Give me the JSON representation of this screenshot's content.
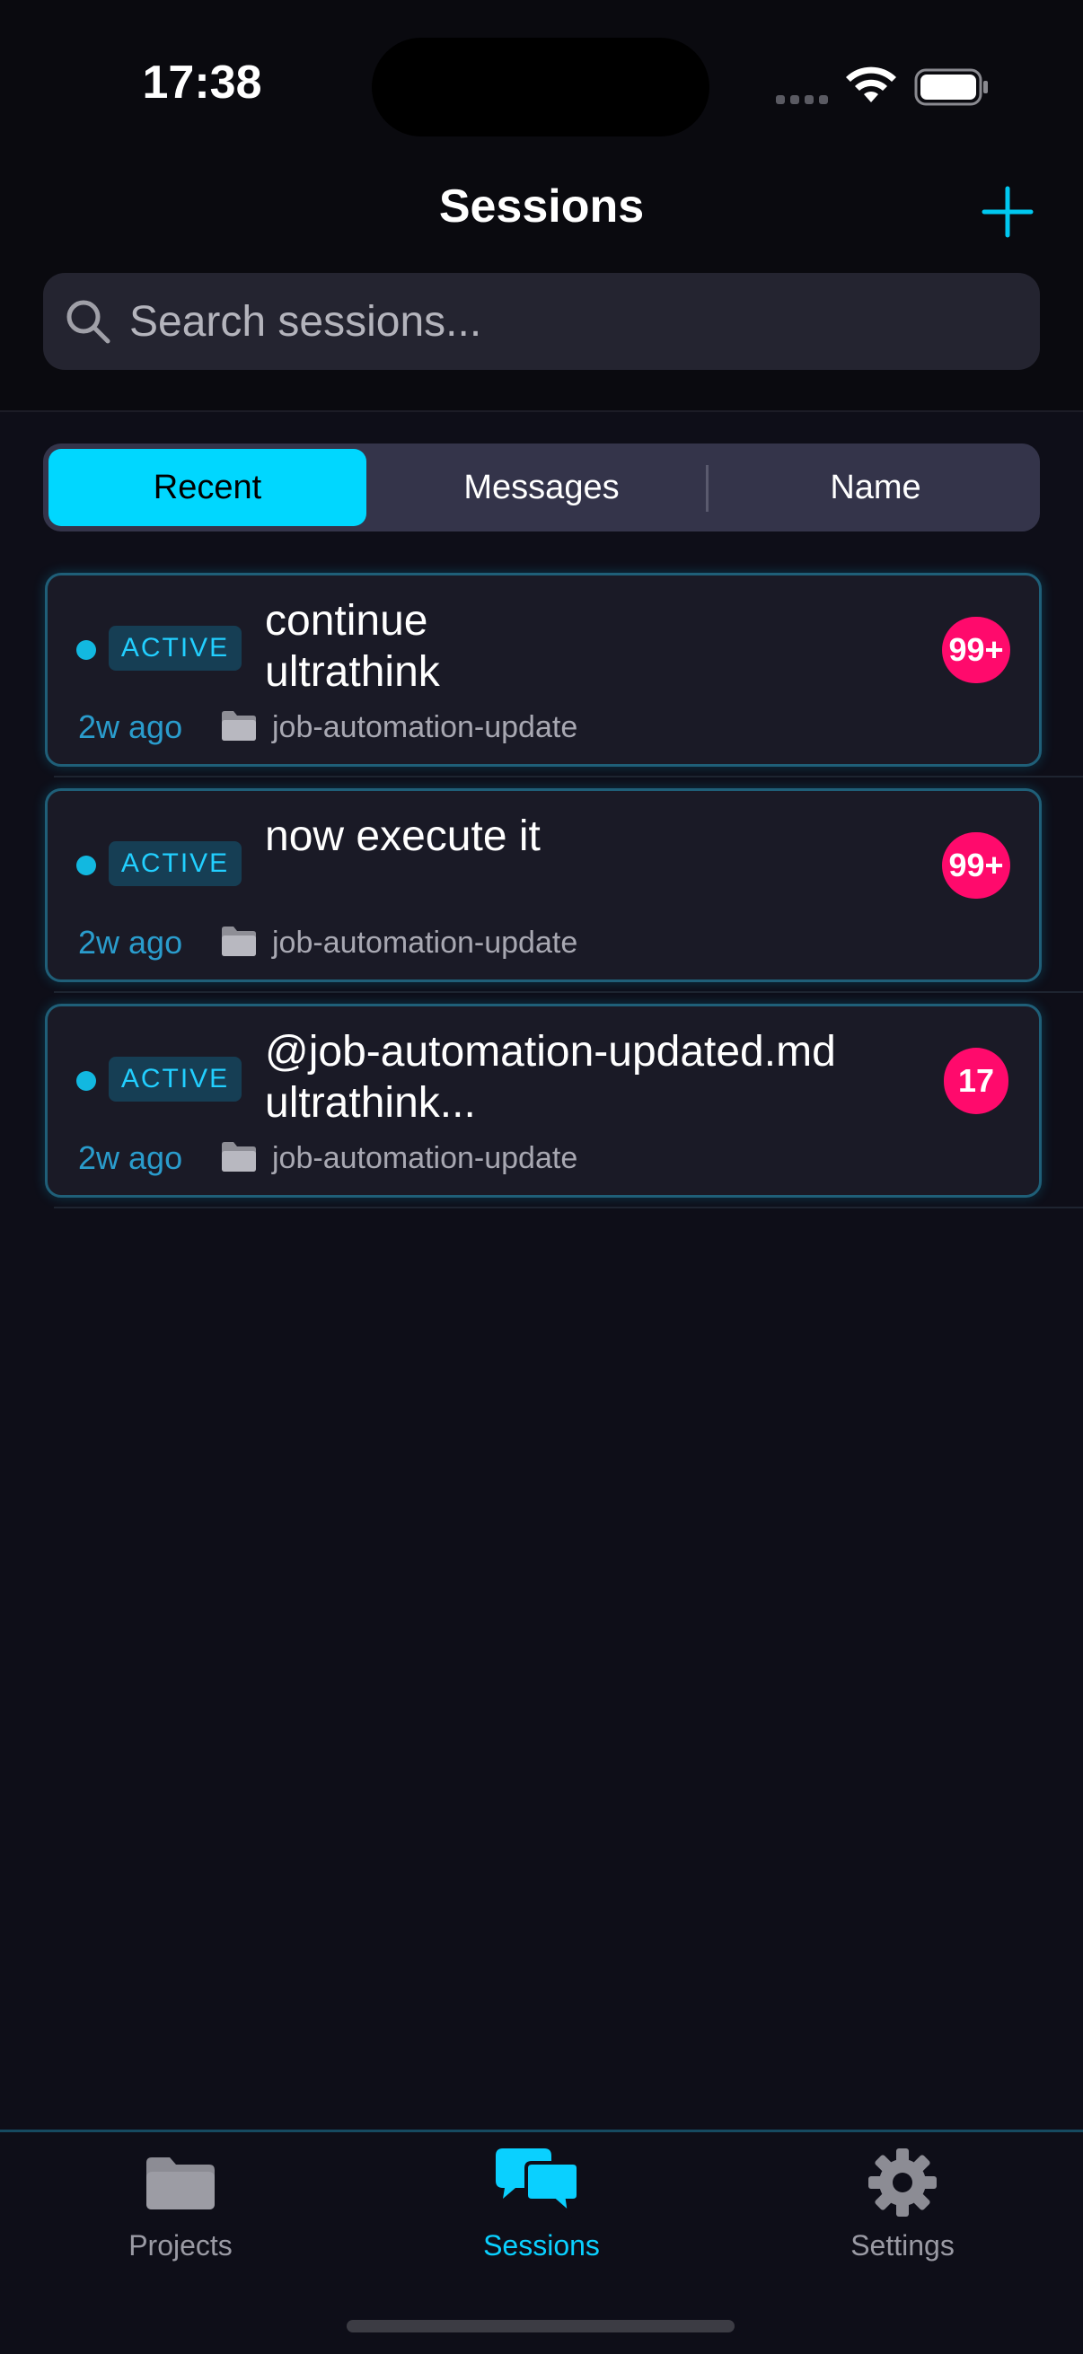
{
  "status_bar": {
    "time": "17:38"
  },
  "header": {
    "title": "Sessions",
    "add_icon": "plus-icon"
  },
  "search": {
    "placeholder": "Search sessions...",
    "value": "",
    "icon": "search-icon"
  },
  "sort_tabs": {
    "options": [
      "Recent",
      "Messages",
      "Name"
    ],
    "selected": "Recent"
  },
  "sessions": [
    {
      "status": "ACTIVE",
      "title": "continue\nultrathink",
      "count": "99+",
      "time_ago": "2w ago",
      "project": "job-automation-update"
    },
    {
      "status": "ACTIVE",
      "title": "now execute it",
      "count": "99+",
      "time_ago": "2w ago",
      "project": "job-automation-update"
    },
    {
      "status": "ACTIVE",
      "title": "@job-automation-updated.md\nultrathink...",
      "count": "17",
      "time_ago": "2w ago",
      "project": "job-automation-update"
    }
  ],
  "tab_bar": {
    "items": [
      {
        "label": "Projects",
        "icon": "folder-icon"
      },
      {
        "label": "Sessions",
        "icon": "chat-bubbles-icon"
      },
      {
        "label": "Settings",
        "icon": "gear-icon"
      }
    ],
    "selected": "Sessions"
  },
  "colors": {
    "accent": "#00d7ff",
    "badge": "#ff0a6c",
    "background": "#0e0e18"
  }
}
